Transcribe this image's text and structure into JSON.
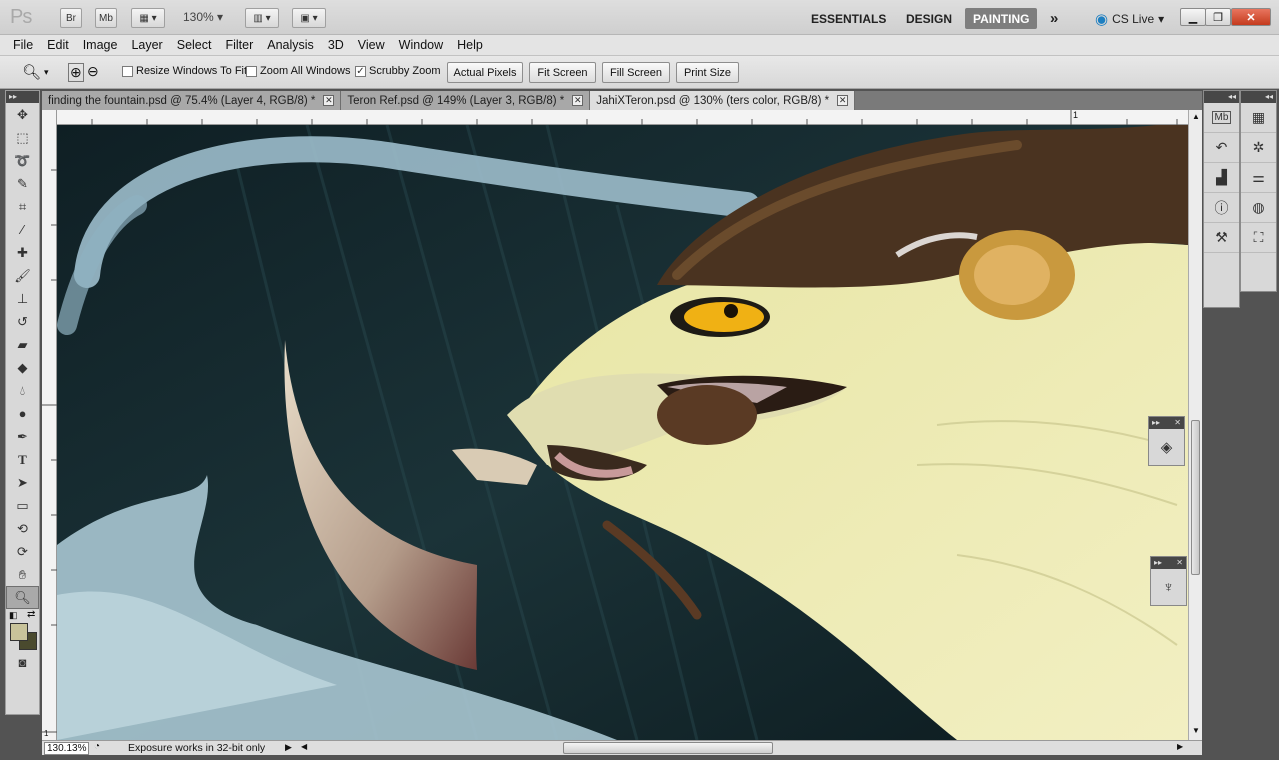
{
  "app": {
    "logo": "Ps",
    "bridge_label": "Br",
    "minibridge_label": "Mb",
    "zoom_level": "130%",
    "workspaces": [
      "ESSENTIALS",
      "DESIGN",
      "PAINTING"
    ],
    "active_workspace": "PAINTING",
    "more_label": "»",
    "cs_live": "CS Live"
  },
  "menu": [
    "File",
    "Edit",
    "Image",
    "Layer",
    "Select",
    "Filter",
    "Analysis",
    "3D",
    "View",
    "Window",
    "Help"
  ],
  "options": {
    "resize_windows": "Resize Windows To Fit",
    "zoom_all": "Zoom All Windows",
    "scrubby_zoom": "Scrubby Zoom",
    "scrubby_checked": true,
    "actual_pixels": "Actual Pixels",
    "fit_screen": "Fit Screen",
    "fill_screen": "Fill Screen",
    "print_size": "Print Size"
  },
  "tabs": [
    {
      "label": "finding the fountain.psd @ 75.4% (Layer 4, RGB/8) *",
      "active": false
    },
    {
      "label": "Teron Ref.psd @ 149% (Layer 3, RGB/8) *",
      "active": false
    },
    {
      "label": "JahiXTeron.psd @ 130% (ters color, RGB/8) *",
      "active": true
    }
  ],
  "ruler": {
    "top_mark": "1",
    "left_mark": "1"
  },
  "status": {
    "zoom": "130.13%",
    "message": "Exposure works in 32-bit only"
  },
  "colors": {
    "foreground": "#c8c39a",
    "background": "#4a4a2e"
  }
}
